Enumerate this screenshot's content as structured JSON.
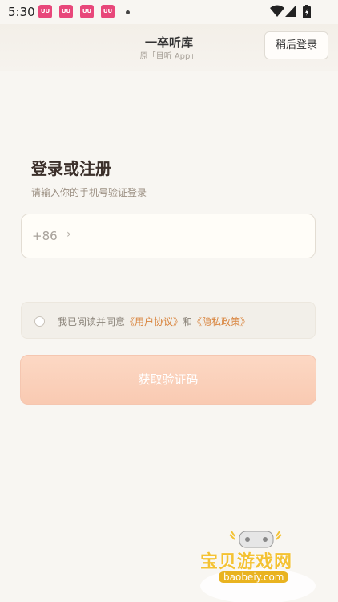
{
  "status_bar": {
    "time": "5:30",
    "notification_count": 4,
    "notif_label": "UU"
  },
  "header": {
    "title": "一卒听库",
    "subtitle": "原「目听 App」",
    "later_button": "稍后登录"
  },
  "login": {
    "title": "登录或注册",
    "subtitle": "请输入你的手机号验证登录"
  },
  "phone": {
    "country_code": "+86",
    "chevron": "›",
    "value": "",
    "placeholder": ""
  },
  "agreement": {
    "prefix": "我已阅读并同意",
    "terms": "《用户协议》",
    "and": "和",
    "privacy": "《隐私政策》",
    "checked": false
  },
  "get_code_button": "获取验证码",
  "watermark": {
    "cn": "宝贝游戏网",
    "en": "baobeiy.com"
  },
  "colors": {
    "accent": "#d9853f",
    "button": "#f9cab2"
  }
}
